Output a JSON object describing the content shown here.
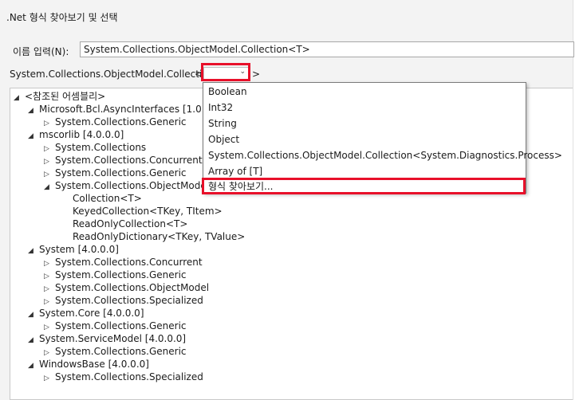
{
  "window": {
    "title": ".Net 형식 찾아보기 및 선택"
  },
  "name_field": {
    "label": "이름 입력(N):",
    "value": "System.Collections.ObjectModel.Collection<T>"
  },
  "generic_row": {
    "prefix": "System.Collections.ObjectModel.Collection",
    "open": "<",
    "close": ">"
  },
  "dropdown": {
    "options": [
      "Boolean",
      "Int32",
      "String",
      "Object",
      "System.Collections.ObjectModel.Collection<System.Diagnostics.Process>",
      "Array of [T]",
      "형식 찾아보기..."
    ]
  },
  "tree": {
    "root": "<참조된 어셈블리>",
    "n1": "Microsoft.Bcl.AsyncInterfaces [1.0.0.0]",
    "n1a": "System.Collections.Generic",
    "n2": "mscorlib [4.0.0.0]",
    "n2a": "System.Collections",
    "n2b": "System.Collections.Concurrent",
    "n2c": "System.Collections.Generic",
    "n2d": "System.Collections.ObjectModel",
    "n2d1": "Collection<T>",
    "n2d2": "KeyedCollection<TKey, TItem>",
    "n2d3": "ReadOnlyCollection<T>",
    "n2d4": "ReadOnlyDictionary<TKey, TValue>",
    "n3": "System [4.0.0.0]",
    "n3a": "System.Collections.Concurrent",
    "n3b": "System.Collections.Generic",
    "n3c": "System.Collections.ObjectModel",
    "n3d": "System.Collections.Specialized",
    "n4": "System.Core [4.0.0.0]",
    "n4a": "System.Collections.Generic",
    "n5": "System.ServiceModel [4.0.0.0]",
    "n5a": "System.Collections.Generic",
    "n6": "WindowsBase [4.0.0.0]",
    "n6a": "System.Collections.Specialized"
  },
  "icons": {
    "expanded": "triangle-expanded-icon",
    "collapsed": "triangle-collapsed-icon",
    "dropdown": "chevron-down-icon"
  },
  "colors": {
    "highlight_border": "#e8102a",
    "window_bg": "#f3f3f3"
  }
}
